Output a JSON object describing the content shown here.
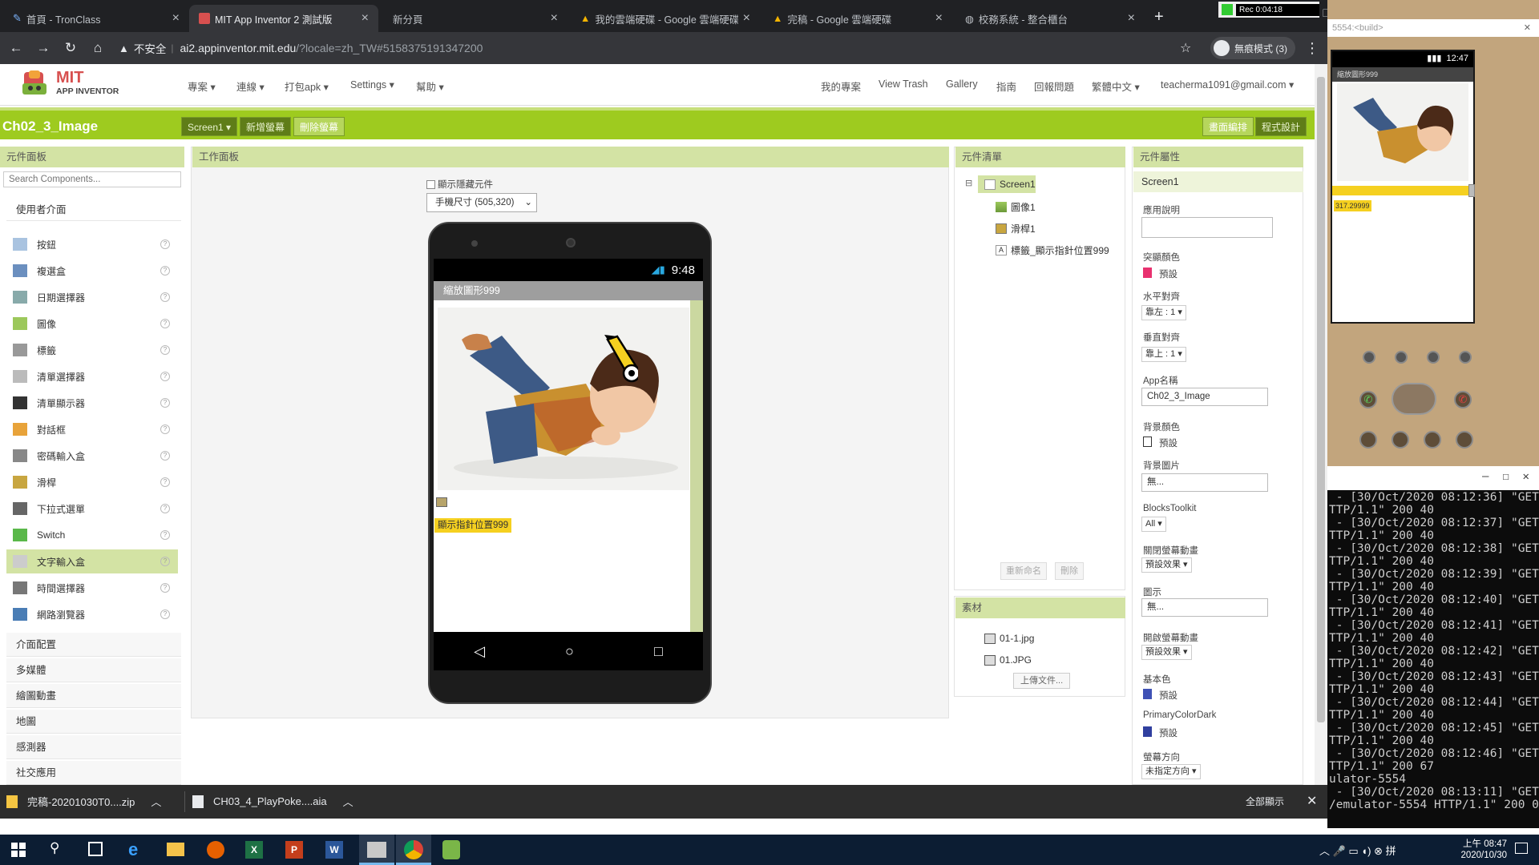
{
  "browser": {
    "tabs": [
      {
        "title": "首頁 - TronClass",
        "active": false
      },
      {
        "title": "MIT App Inventor 2 測試版",
        "active": true
      },
      {
        "title": "新分頁",
        "active": false
      },
      {
        "title": "我的雲端硬碟 - Google 雲端硬碟",
        "active": false
      },
      {
        "title": "完稿 - Google 雲端硬碟",
        "active": false
      },
      {
        "title": "校務系統 - 整合櫃台",
        "active": false
      }
    ],
    "security": "不安全",
    "url_host": "ai2.appinventor.mit.edu",
    "url_path": "/?locale=zh_TW#5158375191347200",
    "incognito": "無痕模式 (3)",
    "rec": "Rec 0:04:18"
  },
  "app": {
    "logo_main": "MIT",
    "logo_sub": "APP INVENTOR",
    "menus": [
      "專案",
      "連線",
      "打包apk",
      "Settings",
      "幫助"
    ],
    "right_menus": [
      "我的專案",
      "View Trash",
      "Gallery",
      "指南",
      "回報問題",
      "繁體中文"
    ],
    "account": "teacherma1091@gmail.com",
    "project_name": "Ch02_3_Image",
    "screen_select": "Screen1",
    "add_screen": "新增螢幕",
    "remove_screen": "刪除螢幕",
    "designer_btn": "畫面編排",
    "blocks_btn": "程式設計"
  },
  "palette": {
    "header": "元件面板",
    "search_placeholder": "Search Components...",
    "open_category": "使用者介面",
    "items": [
      {
        "label": "按鈕",
        "icon": "button-icon"
      },
      {
        "label": "複選盒",
        "icon": "checkbox-icon"
      },
      {
        "label": "日期選擇器",
        "icon": "date-picker-icon"
      },
      {
        "label": "圖像",
        "icon": "image-icon"
      },
      {
        "label": "標籤",
        "icon": "label-icon"
      },
      {
        "label": "清單選擇器",
        "icon": "list-picker-icon"
      },
      {
        "label": "清單顯示器",
        "icon": "list-view-icon"
      },
      {
        "label": "對話框",
        "icon": "notifier-icon"
      },
      {
        "label": "密碼輸入盒",
        "icon": "password-icon"
      },
      {
        "label": "滑桿",
        "icon": "slider-icon"
      },
      {
        "label": "下拉式選單",
        "icon": "spinner-icon"
      },
      {
        "label": "Switch",
        "icon": "switch-icon"
      },
      {
        "label": "文字輸入盒",
        "icon": "textbox-icon"
      },
      {
        "label": "時間選擇器",
        "icon": "time-picker-icon"
      },
      {
        "label": "網路瀏覽器",
        "icon": "web-viewer-icon"
      }
    ],
    "selected_index": 12,
    "categories": [
      "介面配置",
      "多媒體",
      "繪圖動畫",
      "地圖",
      "感測器",
      "社交應用"
    ]
  },
  "viewer": {
    "header": "工作面板",
    "hidden_checkbox": "顯示隱藏元件",
    "size_select": "手機尺寸 (505,320)",
    "phone_time": "9:48",
    "screen_title": "縮放圖形999",
    "label_text": "顯示指針位置999"
  },
  "components": {
    "header": "元件清單",
    "tree": [
      {
        "label": "Screen1",
        "icon": "screen-icon"
      },
      {
        "label": "圖像1",
        "icon": "image-icon"
      },
      {
        "label": "滑桿1",
        "icon": "slider-icon"
      },
      {
        "label": "標籤_顯示指針位置999",
        "icon": "label-icon"
      }
    ],
    "rename": "重新命名",
    "delete": "刪除"
  },
  "media": {
    "header": "素材",
    "files": [
      "01-1.jpg",
      "01.JPG"
    ],
    "upload": "上傳文件..."
  },
  "properties": {
    "header": "元件屬性",
    "component": "Screen1",
    "about_label": "應用說明",
    "accent_label": "突顯顏色",
    "accent_value": "預設",
    "accent_color": "#e8316f",
    "halign_label": "水平對齊",
    "halign_value": "靠左 : 1",
    "valign_label": "垂直對齊",
    "valign_value": "靠上 : 1",
    "appname_label": "App名稱",
    "appname_value": "Ch02_3_Image",
    "bgcolor_label": "背景顏色",
    "bgcolor_value": "預設",
    "bgimage_label": "背景圖片",
    "bgimage_value": "無...",
    "blocks_label": "BlocksToolkit",
    "blocks_value": "All",
    "close_anim_label": "關閉螢幕動畫",
    "close_anim_value": "預設效果",
    "icon_label": "圖示",
    "icon_value": "無...",
    "open_anim_label": "開啟螢幕動畫",
    "open_anim_value": "預設效果",
    "primary_label": "基本色",
    "primary_value": "預設",
    "primary_color": "#3f51b5",
    "primary_dark_label": "PrimaryColorDark",
    "primary_dark_value": "預設",
    "primary_dark_color": "#303f9f",
    "orientation_label": "螢幕方向",
    "orientation_value": "未指定方向"
  },
  "emulator": {
    "title": "5554:<build>",
    "time": "12:47",
    "app_title": "縮放圖形999",
    "slider_readout": "317.29999"
  },
  "terminal": {
    "lines": [
      " - [30/Oct/2020 08:12:36] \"GET",
      "TTP/1.1\" 200 40",
      " - [30/Oct/2020 08:12:37] \"GET",
      "TTP/1.1\" 200 40",
      " - [30/Oct/2020 08:12:38] \"GET",
      "TTP/1.1\" 200 40",
      " - [30/Oct/2020 08:12:39] \"GET",
      "TTP/1.1\" 200 40",
      " - [30/Oct/2020 08:12:40] \"GET",
      "TTP/1.1\" 200 40",
      " - [30/Oct/2020 08:12:41] \"GET",
      "TTP/1.1\" 200 40",
      " - [30/Oct/2020 08:12:42] \"GET",
      "TTP/1.1\" 200 40",
      " - [30/Oct/2020 08:12:43] \"GET",
      "TTP/1.1\" 200 40",
      " - [30/Oct/2020 08:12:44] \"GET",
      "TTP/1.1\" 200 40",
      " - [30/Oct/2020 08:12:45] \"GET",
      "TTP/1.1\" 200 40",
      " - [30/Oct/2020 08:12:46] \"GET",
      "TTP/1.1\" 200 67",
      "ulator-5554",
      " - [30/Oct/2020 08:13:11] \"GET",
      "/emulator-5554 HTTP/1.1\" 200 0"
    ]
  },
  "downloads": {
    "items": [
      "完稿-20201030T0....zip",
      "CH03_4_PlayPoke....aia"
    ],
    "show_all": "全部顯示"
  },
  "taskbar": {
    "time": "上午 08:47",
    "date": "2020/10/30"
  }
}
